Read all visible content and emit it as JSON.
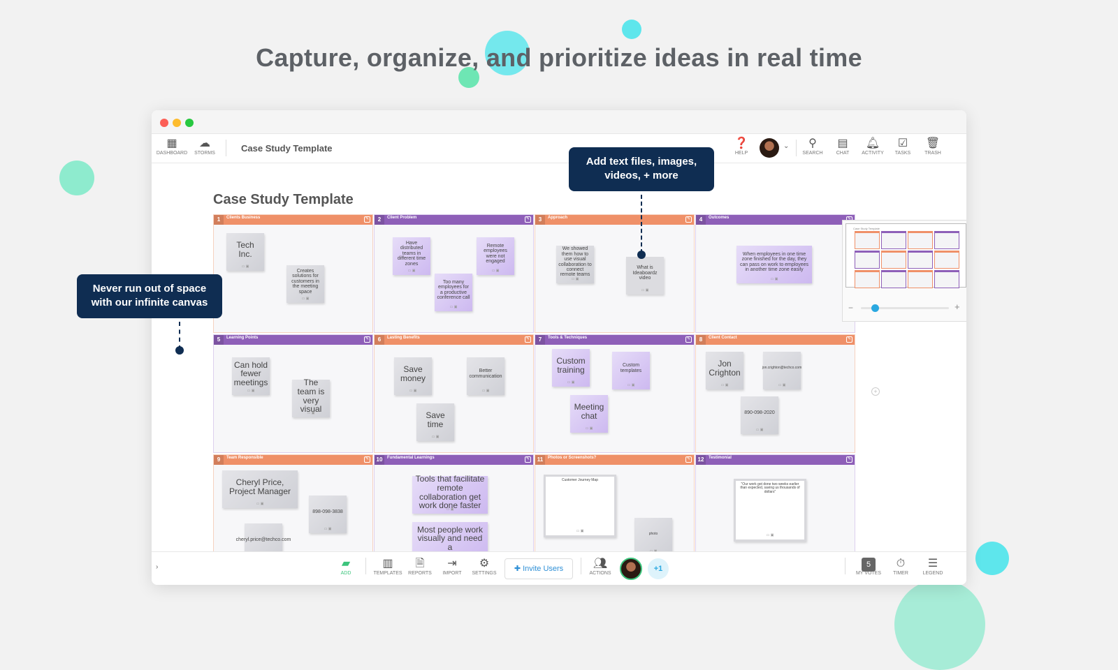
{
  "headline": "Capture, organize, and prioritize ideas in real time",
  "colors": {
    "orange": "#ef9068",
    "purple": "#8e5fb8",
    "navy": "#0f2d52",
    "accent_blue": "#2e8fd6",
    "green": "#3cc47c"
  },
  "topbar": {
    "left": [
      {
        "icon": "grid-icon",
        "label": "DASHBOARD"
      },
      {
        "icon": "cloud-icon",
        "label": "STORMS"
      }
    ],
    "doc_title": "Case Study Template",
    "right": [
      {
        "icon": "help-icon",
        "label": "HELP"
      },
      {
        "icon": "search-icon",
        "label": "SEARCH"
      },
      {
        "icon": "chat-icon",
        "label": "CHAT"
      },
      {
        "icon": "bell-icon",
        "label": "ACTIVITY"
      },
      {
        "icon": "calendar-check-icon",
        "label": "TASKS"
      },
      {
        "icon": "trash-icon",
        "label": "TRASH"
      }
    ]
  },
  "canvas": {
    "title": "Case Study Template",
    "cells": [
      {
        "num": "1",
        "name": "Clients Business",
        "notes": [
          "Tech Inc.",
          "Creates solutions for customers in the meeting space"
        ]
      },
      {
        "num": "2",
        "name": "Client Problem",
        "notes": [
          "Have distributed teams in different time zones",
          "Too many employees for a productive conference call",
          "Remote employees were not engaged"
        ]
      },
      {
        "num": "3",
        "name": "Approach",
        "notes": [
          "We showed them how to use visual collaboration to connect remote teams",
          "What is Ideaboardz video"
        ]
      },
      {
        "num": "4",
        "name": "Outcomes",
        "notes": [
          "When employees in one time zone finished for the day, they can pass on work to employees in another time zone easily"
        ]
      },
      {
        "num": "5",
        "name": "Learning Points",
        "notes": [
          "Can hold fewer meetings",
          "The team is very visual"
        ]
      },
      {
        "num": "6",
        "name": "Lasting Benefits",
        "notes": [
          "Save money",
          "Better communication",
          "Save time"
        ]
      },
      {
        "num": "7",
        "name": "Tools & Techniques",
        "notes": [
          "Custom training",
          "Custom templates",
          "Meeting chat"
        ]
      },
      {
        "num": "8",
        "name": "Client Contact",
        "notes": [
          "Jon Crighton",
          "jon.crighton@techco.com",
          "890-098-2020"
        ]
      },
      {
        "num": "9",
        "name": "Team Responsible",
        "notes": [
          "Cheryl Price, Project Manager",
          "898-098-3838",
          "cheryl.price@techco.com"
        ]
      },
      {
        "num": "10",
        "name": "Fundamental Learnings",
        "notes": [
          "Tools that facilitate remote collaboration get work done faster",
          "Most people work visually and need a"
        ]
      },
      {
        "num": "11",
        "name": "Photos or Screenshots?",
        "notes": [
          "Customer Journey Map",
          "photo"
        ]
      },
      {
        "num": "12",
        "name": "Testimonial",
        "notes": [
          "\"Our work got done two weeks earlier than expected, saving us thousands of dollars\""
        ]
      }
    ]
  },
  "tooltips": {
    "files": "Add text files, images, videos, + more",
    "canvas": "Never run out of space with our infinite canvas"
  },
  "bottombar": {
    "add": "ADD",
    "templates": "TEMPLATES",
    "reports": "REPORTS",
    "import": "IMPORT",
    "settings": "SETTINGS",
    "invite": "Invite Users",
    "actions": "ACTIONS",
    "extra_users": "+1",
    "votes_count": "5",
    "votes": "MY VOTES",
    "timer": "TIMER",
    "legend": "LEGEND"
  },
  "minimap": {
    "title": "Case Study Template",
    "zoom_level": 0.12
  }
}
